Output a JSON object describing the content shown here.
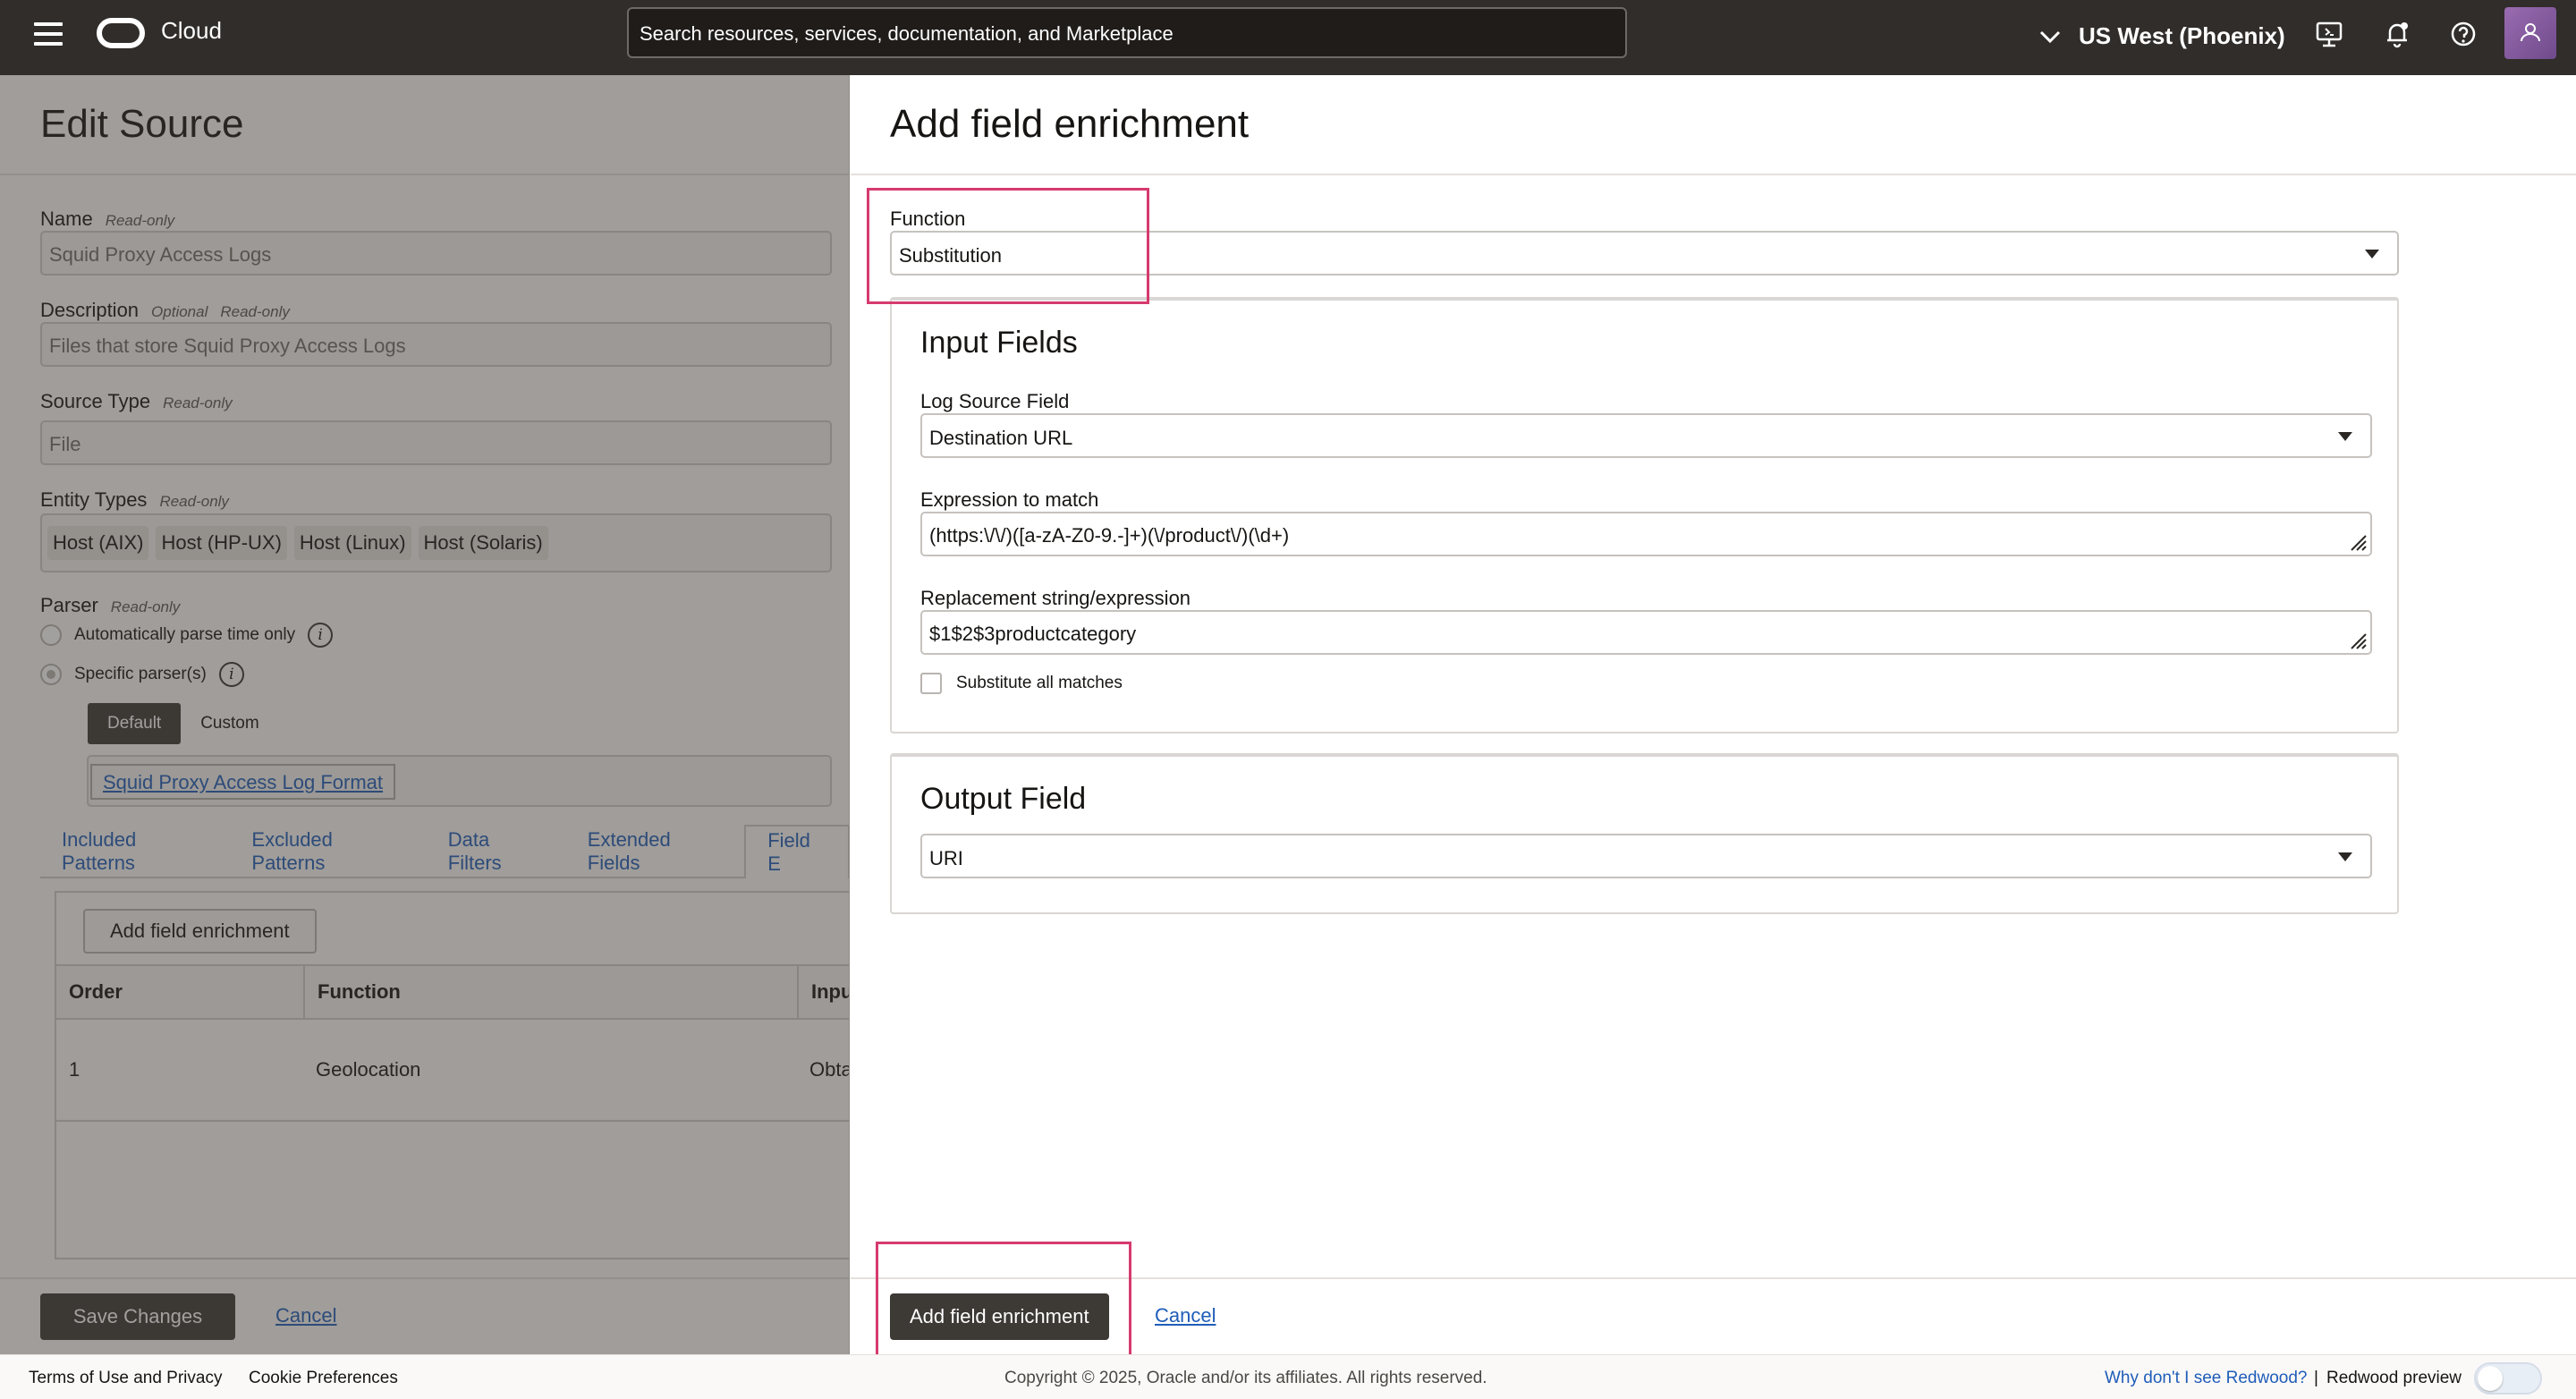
{
  "topbar": {
    "brand": "Cloud",
    "search_placeholder": "Search resources, services, documentation, and Marketplace",
    "region": "US West (Phoenix)",
    "icons": [
      "menu-icon",
      "chevron-down-icon",
      "developer-tools-icon",
      "bell-icon",
      "help-icon",
      "avatar"
    ]
  },
  "left_panel": {
    "title": "Edit Source",
    "name_label": "Name",
    "read_only": "Read-only",
    "optional": "Optional",
    "name_value": "Squid Proxy Access Logs",
    "description_label": "Description",
    "description_value": "Files that store Squid Proxy Access Logs",
    "source_type_label": "Source Type",
    "source_type_value": "File",
    "entity_types_label": "Entity Types",
    "entity_types": [
      "Host (AIX)",
      "Host (HP-UX)",
      "Host (Linux)",
      "Host (Solaris)"
    ],
    "parser_label": "Parser",
    "parser_options": [
      "Automatically parse time only",
      "Specific parser(s)"
    ],
    "segment": [
      "Default",
      "Custom"
    ],
    "parser_link": "Squid Proxy Access Log Format",
    "tabs": [
      "Included Patterns",
      "Excluded Patterns",
      "Data Filters",
      "Extended Fields",
      "Field E"
    ],
    "add_button": "Add field enrichment",
    "table": {
      "headers": [
        "Order",
        "Function",
        "Inpu"
      ],
      "rows": [
        [
          "1",
          "Geolocation",
          "Obta"
        ]
      ]
    },
    "save_button": "Save Changes",
    "cancel": "Cancel"
  },
  "drawer": {
    "title": "Add field enrichment",
    "function_label": "Function",
    "function_value": "Substitution",
    "input_fields_title": "Input Fields",
    "log_source_field_label": "Log Source Field",
    "log_source_field_value": "Destination URL",
    "expression_label": "Expression to match",
    "expression_value": "(https:\\/\\/)([a-zA-Z0-9.-]+)(\\/product\\/)(\\d+)",
    "replacement_label": "Replacement string/expression",
    "replacement_value": "$1$2$3productcategory",
    "substitute_all_label": "Substitute all matches",
    "output_field_title": "Output Field",
    "output_field_value": "URI",
    "primary_button": "Add field enrichment",
    "cancel": "Cancel"
  },
  "footer": {
    "terms": "Terms of Use and Privacy",
    "cookies": "Cookie Preferences",
    "copyright": "Copyright © 2025, Oracle and/or its affiliates. All rights reserved.",
    "redwood_link": "Why don't I see Redwood?",
    "separator": "|",
    "redwood_preview": "Redwood preview"
  },
  "colors": {
    "topbar": "#312d2a",
    "highlight": "#d63a6e",
    "link": "#1f5db8",
    "primary_button": "#3d3935"
  }
}
